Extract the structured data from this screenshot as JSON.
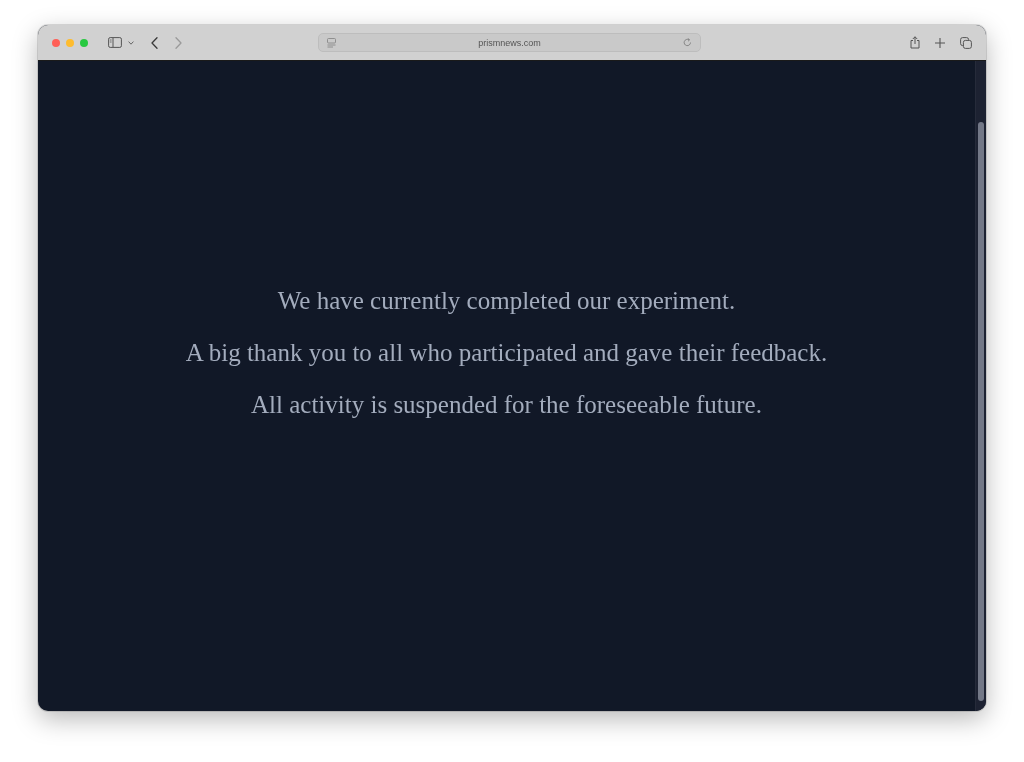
{
  "browser": {
    "address": "prismnews.com",
    "back_enabled": true,
    "forward_enabled": false
  },
  "page": {
    "paragraphs": [
      "We have currently completed our experiment.",
      "A big thank you to all who participated and gave their feedback.",
      "All activity is suspended for the foreseeable future."
    ]
  }
}
